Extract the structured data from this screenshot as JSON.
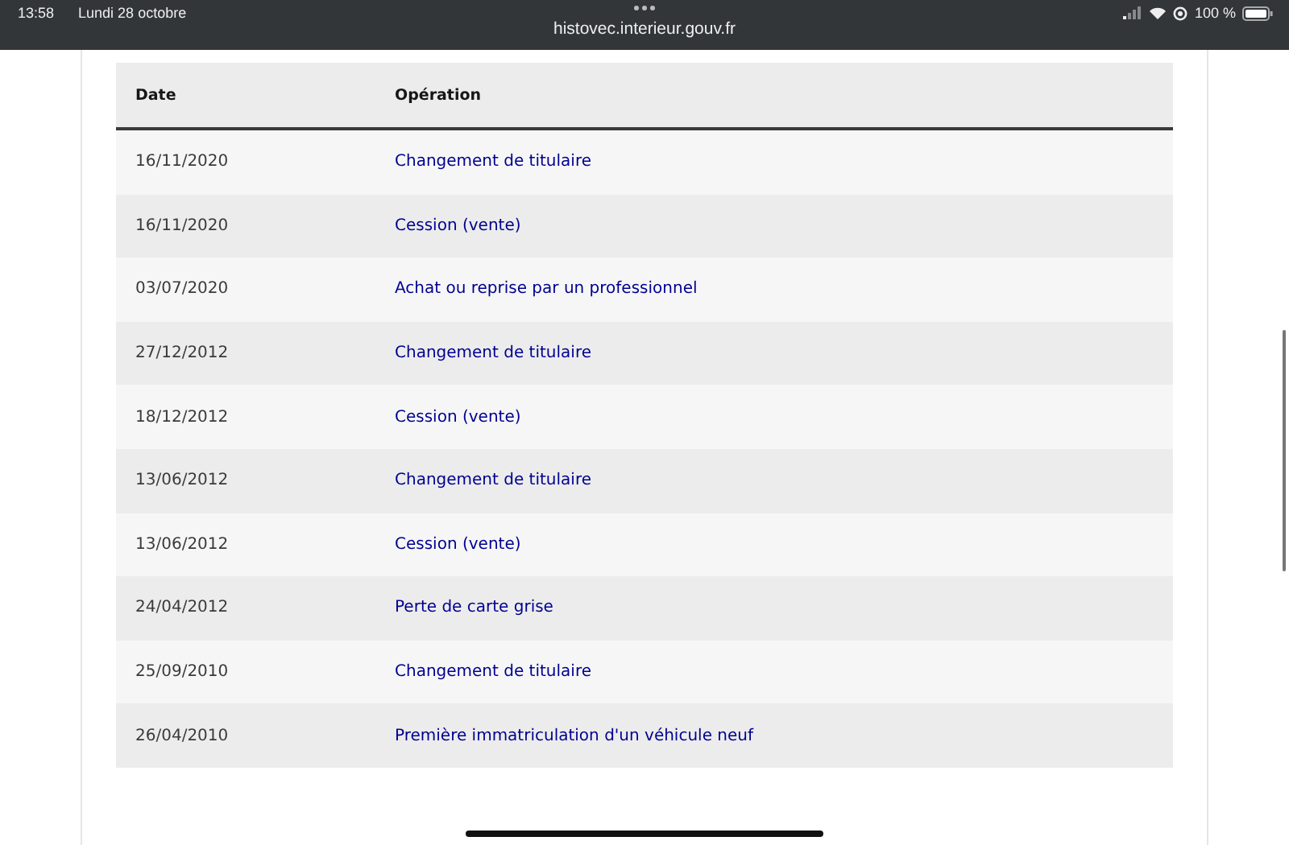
{
  "status_bar": {
    "time": "13:58",
    "date": "Lundi 28 octobre",
    "url": "histovec.interieur.gouv.fr",
    "battery": "100 %"
  },
  "table": {
    "columns": [
      "Date",
      "Opération"
    ],
    "rows": [
      {
        "date": "16/11/2020",
        "operation": "Changement de titulaire"
      },
      {
        "date": "16/11/2020",
        "operation": "Cession (vente)"
      },
      {
        "date": "03/07/2020",
        "operation": "Achat ou reprise par un professionnel"
      },
      {
        "date": "27/12/2012",
        "operation": "Changement de titulaire"
      },
      {
        "date": "18/12/2012",
        "operation": "Cession (vente)"
      },
      {
        "date": "13/06/2012",
        "operation": "Changement de titulaire"
      },
      {
        "date": "13/06/2012",
        "operation": "Cession (vente)"
      },
      {
        "date": "24/04/2012",
        "operation": "Perte de carte grise"
      },
      {
        "date": "25/09/2010",
        "operation": "Changement de titulaire"
      },
      {
        "date": "26/04/2010",
        "operation": "Première immatriculation d'un véhicule neuf"
      }
    ]
  }
}
